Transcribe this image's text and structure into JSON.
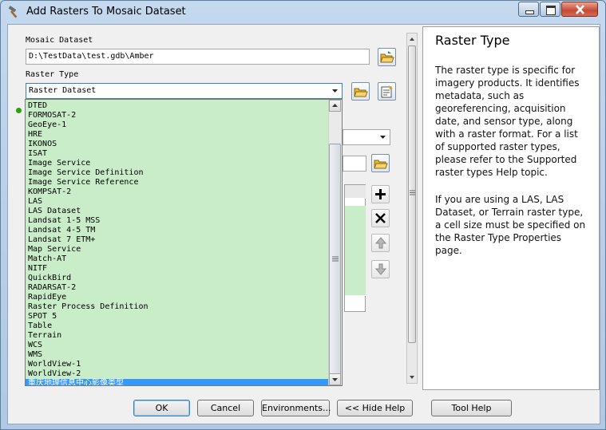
{
  "window": {
    "title": "Add Rasters To Mosaic Dataset"
  },
  "form": {
    "mosaic_label": "Mosaic Dataset",
    "mosaic_value": "D:\\TestData\\test.gdb\\Amber",
    "raster_type_label": "Raster Type",
    "raster_type_value": "Raster Dataset"
  },
  "dropdown": {
    "items": [
      "DTED",
      "FORMOSAT-2",
      "GeoEye-1",
      "HRE",
      "IKONOS",
      "ISAT",
      "Image Service",
      "Image Service Definition",
      "Image Service Reference",
      "KOMPSAT-2",
      "LAS",
      "LAS Dataset",
      "Landsat 1-5 MSS",
      "Landsat 4-5 TM",
      "Landsat 7 ETM+",
      "Map Service",
      "Match-AT",
      "NITF",
      "QuickBird",
      "RADARSAT-2",
      "RapidEye",
      "Raster Process Definition",
      "SPOT 5",
      "Table",
      "Terrain",
      "WCS",
      "WMS",
      "WorldView-1",
      "WorldView-2",
      "重庆地理信息中心影像类型"
    ],
    "selected_index": 29
  },
  "help": {
    "title": "Raster Type",
    "p1": "The raster type is specific for imagery products. It identifies metadata, such as georeferencing, acquisition date, and sensor type, along with a raster format. For a list of supported raster types, please refer to the Supported raster types Help topic.",
    "p2": "If you are using a LAS, LAS Dataset, or Terrain raster type, a cell size must be specified on the Raster Type Properties page."
  },
  "buttons": {
    "ok": "OK",
    "cancel": "Cancel",
    "environments": "Environments...",
    "hide_help": "<< Hide Help",
    "tool_help": "Tool Help"
  },
  "colors": {
    "list_bg": "#c9ecc9",
    "selection": "#3399ff",
    "window_frame": "#b9d1ea"
  }
}
